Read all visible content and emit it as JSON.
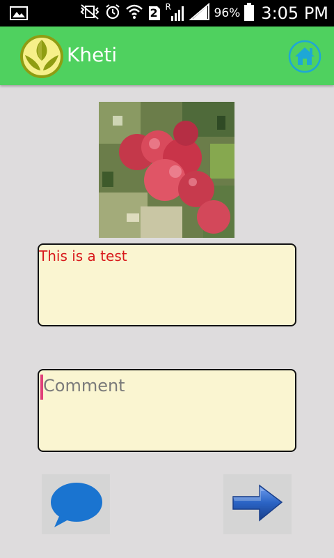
{
  "status_bar": {
    "battery_percent": "96%",
    "time": "3:05 PM",
    "sim_slot": "2",
    "roaming": "R"
  },
  "app_bar": {
    "title": "Kheti",
    "logo_icon": "leaf-logo-icon",
    "home_icon": "home-icon"
  },
  "colors": {
    "app_bar": "#4fd15f",
    "field_background": "#faf5d1",
    "description_text": "#d8191b",
    "home_icon": "#1ea7d6",
    "chat_icon": "#1a74d0",
    "arrow_icon": "#2a63c4"
  },
  "post": {
    "image_icon": "apples-photo",
    "description": "This is a test"
  },
  "comment": {
    "value": "",
    "placeholder": "Comment"
  },
  "actions": {
    "chat_icon": "speech-bubble-icon",
    "next_icon": "arrow-right-icon"
  }
}
